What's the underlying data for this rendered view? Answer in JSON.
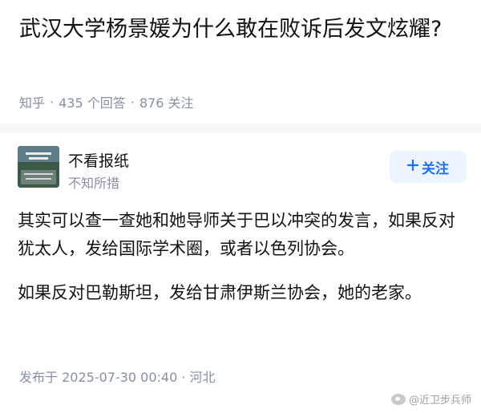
{
  "question": {
    "title": "武汉大学杨景媛为什么敢在败诉后发文炫耀?",
    "source": "知乎",
    "answers": "435 个回答",
    "followers": "876 关注"
  },
  "author": {
    "name": "不看报纸",
    "bio": "不知所措",
    "follow_label": "关注",
    "follow_icon": "plus-icon",
    "avatar_text_top": "AS YOU TO HEAVEN"
  },
  "answer": {
    "paragraphs": [
      "其实可以查一查她和她导师关于巴以冲突的发言，如果反对犹太人，发给国际学术圈，或者以色列协会。",
      "如果反对巴勒斯坦，发给甘肃伊斯兰协会，她的老家。"
    ],
    "published": "发布于 2025-07-30 00:40 · 河北"
  },
  "watermark": {
    "text": "@近卫步兵师",
    "icon": "weibo-icon"
  },
  "colors": {
    "accent": "#1772f6",
    "meta": "#8590a6",
    "follow_bg": "#eef4ff"
  }
}
